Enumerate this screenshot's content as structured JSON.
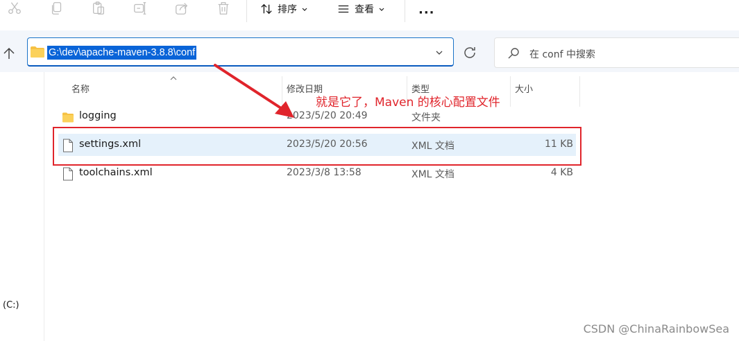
{
  "toolbar": {
    "icons": [
      "cut-icon",
      "copy-icon",
      "paste-icon",
      "rename-icon",
      "share-icon",
      "delete-icon"
    ],
    "sort_label": "排序",
    "view_label": "查看",
    "more_label": "···"
  },
  "address": {
    "path": "G:\\dev\\apache-maven-3.8.8\\conf"
  },
  "search": {
    "placeholder": "在 conf 中搜索"
  },
  "sidebar": {
    "drive_label": "(C:)"
  },
  "columns": {
    "name": "名称",
    "date": "修改日期",
    "type": "类型",
    "size": "大小"
  },
  "files": [
    {
      "name": "logging",
      "date": "2023/5/20 20:49",
      "type": "文件夹",
      "size": "",
      "kind": "folder"
    },
    {
      "name": "settings.xml",
      "date": "2023/5/20 20:56",
      "type": "XML 文档",
      "size": "11 KB",
      "kind": "file",
      "selected": true
    },
    {
      "name": "toolchains.xml",
      "date": "2023/3/8 13:58",
      "type": "XML 文档",
      "size": "4 KB",
      "kind": "file"
    }
  ],
  "annotation": {
    "text": "就是它了，Maven 的核心配置文件",
    "color": "#e0242b"
  },
  "watermark": "CSDN @ChinaRainbowSea",
  "colors": {
    "accent": "#0a64d8",
    "selection": "#e5f1fb",
    "folder": "#f6c143"
  }
}
